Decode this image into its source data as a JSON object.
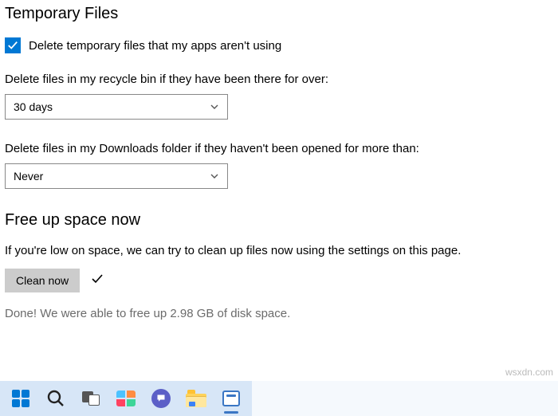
{
  "sections": {
    "temp_files": {
      "header": "Temporary Files",
      "checkbox_label": "Delete temporary files that my apps aren't using",
      "checkbox_checked": true,
      "recycle_label": "Delete files in my recycle bin if they have been there for over:",
      "recycle_value": "30 days",
      "downloads_label": "Delete files in my Downloads folder if they haven't been opened for more than:",
      "downloads_value": "Never"
    },
    "free_up": {
      "header": "Free up space now",
      "description": "If you're low on space, we can try to clean up files now using the settings on this page.",
      "button_label": "Clean now",
      "status": "Done! We were able to free up 2.98 GB of disk space."
    }
  },
  "watermark": "wsxdn.com"
}
